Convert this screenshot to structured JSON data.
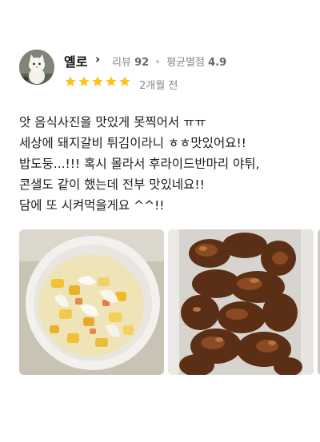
{
  "review": {
    "author_name": "옐로",
    "review_count_label": "리뷰",
    "review_count": "92",
    "avg_rating_label": "평균별점",
    "avg_rating": "4.9",
    "rating_stars": 5,
    "date": "2개월 전",
    "text_lines": [
      "앗 음식사진을 맛있게 못찍어서 ㅠㅠ",
      "세상에  돼지갈비 튀김이라니 ㅎㅎ맛있어요!!",
      "밥도둥...!!! 혹시 몰라서 후라이드반마리 야튀,",
      "콘샐도 같이 했는데 전부 맛있네요!!",
      "담에 또 시켜먹을게요 ^^!!"
    ],
    "colors": {
      "star": "#fcc419",
      "meta": "#888888"
    }
  }
}
